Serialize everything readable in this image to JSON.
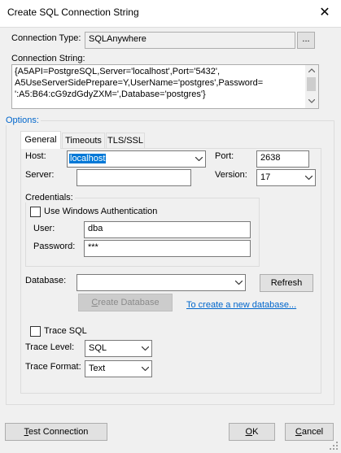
{
  "window": {
    "title": "Create SQL Connection String",
    "close_glyph": "✕"
  },
  "connection_type": {
    "label": "Connection Type:",
    "value": "SQLAnywhere",
    "browse_label": "..."
  },
  "connection_string": {
    "label": "Connection String:",
    "lines": [
      "{A5API=PostgreSQL,Server='localhost',Port='5432',",
      "A5UseServerSidePrepare=Y,UserName='postgres',Password=",
      "':A5:B64:cG9zdGdyZXM=',Database='postgres'}"
    ]
  },
  "options": {
    "label": "Options:",
    "tabs": [
      {
        "label": "General"
      },
      {
        "label": "Timeouts"
      },
      {
        "label": "TLS/SSL"
      }
    ]
  },
  "general": {
    "host_label": "Host:",
    "host_value": "localhost",
    "port_label": "Port:",
    "port_value": "2638",
    "server_label": "Server:",
    "server_value": "",
    "version_label": "Version:",
    "version_value": "17",
    "credentials_label": "Credentials:",
    "windows_auth_label": "Use Windows Authentication",
    "user_label": "User:",
    "user_value": "dba",
    "password_label": "Password:",
    "password_value": "***",
    "database_label": "Database:",
    "database_value": "",
    "refresh_label": "Refresh",
    "create_db_prefix": "C",
    "create_db_rest": "reate Database",
    "create_db_link": "To create a new database...",
    "trace_sql_label": "Trace SQL",
    "trace_level_label": "Trace Level:",
    "trace_level_value": "SQL",
    "trace_format_label": "Trace Format:",
    "trace_format_value": "Text"
  },
  "footer": {
    "test_prefix": "T",
    "test_rest": "est Connection",
    "ok_prefix": "O",
    "ok_rest": "K",
    "cancel_prefix": "C",
    "cancel_rest": "ancel"
  },
  "colors": {
    "link": "#0066cc",
    "selection": "#0078d7",
    "options_label": "#0066cc"
  }
}
